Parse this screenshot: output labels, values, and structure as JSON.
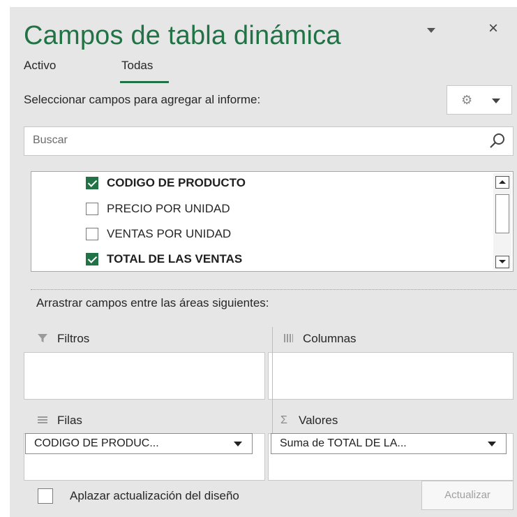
{
  "header": {
    "title": "Campos de tabla dinámica",
    "dropdown_icon": "chevron-down-icon",
    "close_label": "×"
  },
  "tabs": [
    {
      "label": "Activo",
      "active": false
    },
    {
      "label": "Todas",
      "active": true
    }
  ],
  "field_section": {
    "label": "Seleccionar campos para agregar al informe:",
    "tools_icon": "gear-icon"
  },
  "search": {
    "placeholder": "Buscar",
    "value": ""
  },
  "fields": [
    {
      "label": "CODIGO DE PRODUCTO",
      "checked": true
    },
    {
      "label": "PRECIO POR UNIDAD",
      "checked": false
    },
    {
      "label": "VENTAS POR UNIDAD",
      "checked": false
    },
    {
      "label": "TOTAL DE LAS VENTAS",
      "checked": true
    }
  ],
  "areas": {
    "label": "Arrastrar campos entre las áreas siguientes:",
    "filters": {
      "label": "Filtros",
      "icon": "filter-icon"
    },
    "columns": {
      "label": "Columnas",
      "icon": "columns-icon"
    },
    "rows": {
      "label": "Filas",
      "icon": "rows-icon",
      "items": [
        "CODIGO DE PRODUC..."
      ]
    },
    "values": {
      "label": "Valores",
      "icon": "sigma-icon",
      "items": [
        "Suma de TOTAL DE LA..."
      ]
    }
  },
  "footer": {
    "defer_label": "Aplazar actualización del diseño",
    "defer_checked": false,
    "update_label": "Actualizar"
  },
  "colors": {
    "accent": "#217346",
    "panel_bg": "#e6e6e6"
  }
}
